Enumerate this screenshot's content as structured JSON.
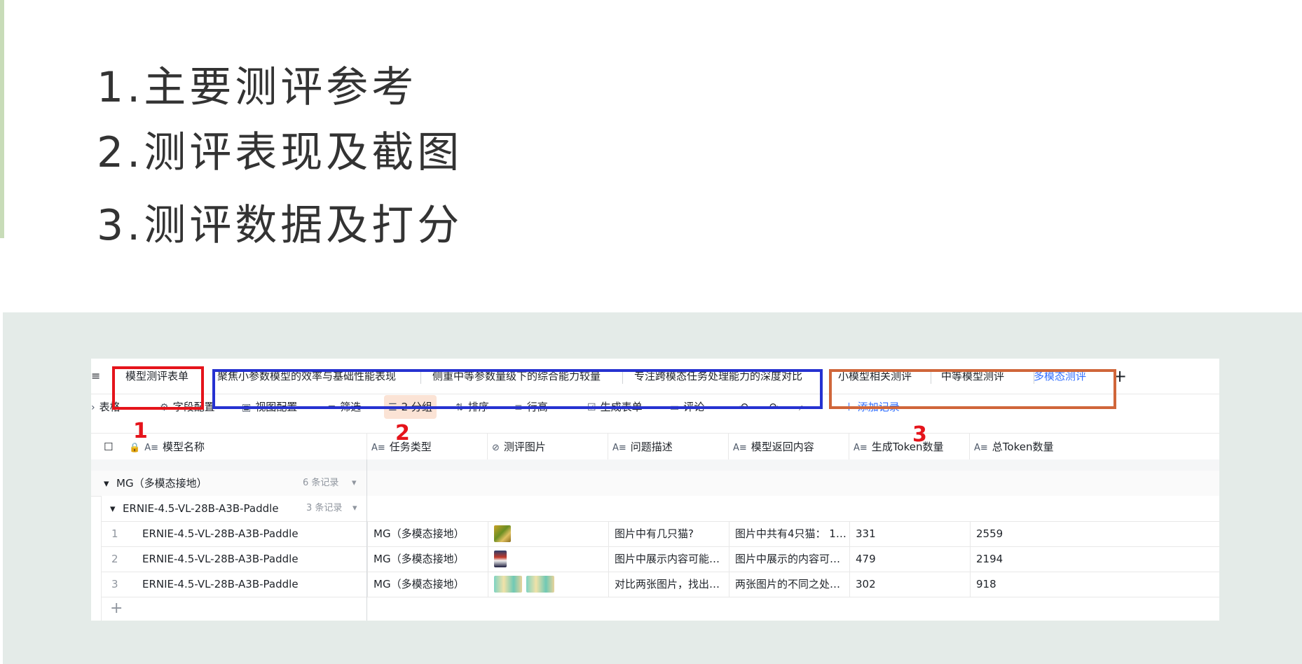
{
  "headings": [
    "1.主要测评参考",
    "2.测评表现及截图",
    "3.测评数据及打分"
  ],
  "app": {
    "menu_glyph": "≡",
    "tabs": [
      {
        "label": "模型测评表单",
        "active": false
      },
      {
        "label": "聚焦小参数模型的效率与基础性能表现",
        "active": false
      },
      {
        "label": "侧重中等参数量级下的综合能力较量",
        "active": false
      },
      {
        "label": "专注跨模态任务处理能力的深度对比",
        "active": false
      },
      {
        "label": "小模型相关测评",
        "active": false
      },
      {
        "label": "中等模型测评",
        "active": false
      },
      {
        "label": "多模态测评",
        "active": true
      }
    ],
    "add_tab": "+",
    "toolbar": {
      "view": "表格",
      "field_config": "字段配置",
      "view_config": "视图配置",
      "filter": "筛选",
      "group": "2 分组",
      "sort": "排序",
      "row_height": "行高",
      "gen_form": "生成表单",
      "comment": "评论",
      "add_record": "添加记录"
    },
    "columns": [
      "模型名称",
      "任务类型",
      "测评图片",
      "问题描述",
      "模型返回内容",
      "生成Token数量",
      "总Token数量"
    ],
    "group1": {
      "label": "MG（多模态接地）",
      "count": "6 条记录"
    },
    "group2": {
      "label": "ERNIE-4.5-VL-28B-A3B-Paddle",
      "count": "3 条记录"
    },
    "rows": [
      {
        "idx": "1",
        "model": "ERNIE-4.5-VL-28B-A3B-Paddle",
        "task": "MG（多模态接地）",
        "question": "图片中有几只猫?",
        "answer": "图片中共有4只猫： 1. ...",
        "gen_tokens": "331",
        "total_tokens": "2559"
      },
      {
        "idx": "2",
        "model": "ERNIE-4.5-VL-28B-A3B-Paddle",
        "task": "MG（多模态接地）",
        "question": "图片中展示内容可能发...",
        "answer": "图片中展示的内容可能...",
        "gen_tokens": "479",
        "total_tokens": "2194"
      },
      {
        "idx": "3",
        "model": "ERNIE-4.5-VL-28B-A3B-Paddle",
        "task": "MG（多模态接地）",
        "question": "对比两张图片，找出它...",
        "answer": "两张图片的不同之处在...",
        "gen_tokens": "302",
        "total_tokens": "918"
      }
    ],
    "add_row": "+"
  },
  "annotations": [
    "1",
    "2",
    "3"
  ],
  "colors": {
    "red": "#e5141b",
    "blue": "#2632d1",
    "orange": "#d0663a",
    "accent": "#3370ff",
    "bottom_bg": "#e4ebe8"
  }
}
